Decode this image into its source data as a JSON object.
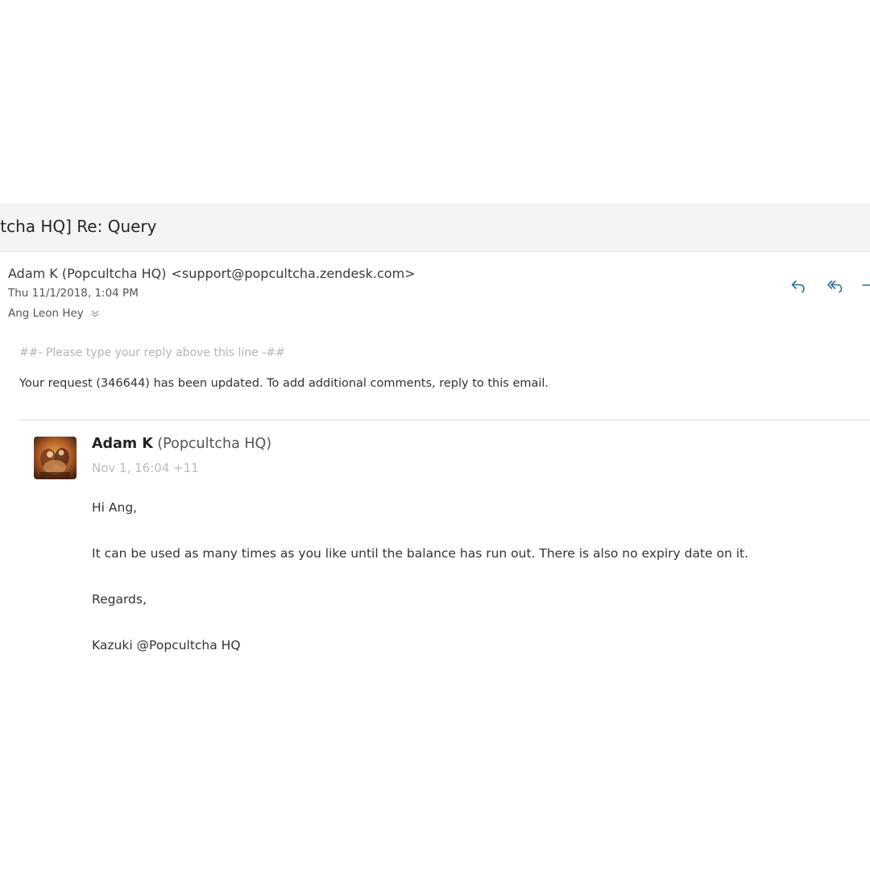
{
  "email": {
    "subject": "ultcha HQ] Re: Query",
    "sender_name": "Adam K (Popcultcha HQ)",
    "sender_address": "<support@popcultcha.zendesk.com>",
    "date": "Thu 11/1/2018, 1:04 PM",
    "recipient": "Ang Leon Hey"
  },
  "actions": {
    "reply_icon": "reply-icon",
    "reply_all_icon": "reply-all-icon",
    "forward_icon": "forward-icon"
  },
  "body": {
    "reply_marker": "##- Please type your reply above this line -##",
    "request_notice": "Your request (346644) has been updated. To add additional comments, reply to this email."
  },
  "comment": {
    "author_name": "Adam K",
    "author_org": "(Popcultcha HQ)",
    "timestamp": "Nov 1, 16:04 +11",
    "greeting": "Hi Ang,",
    "message": "It can be used as many times as you like until the balance has run out. There is also no expiry date on it.",
    "regards": "Regards,",
    "signature": "Kazuki @Popcultcha HQ"
  },
  "colors": {
    "action_icon": "#2f6f9f",
    "subject_bar": "#f4f4f4",
    "muted_text": "#b4b4b4"
  }
}
